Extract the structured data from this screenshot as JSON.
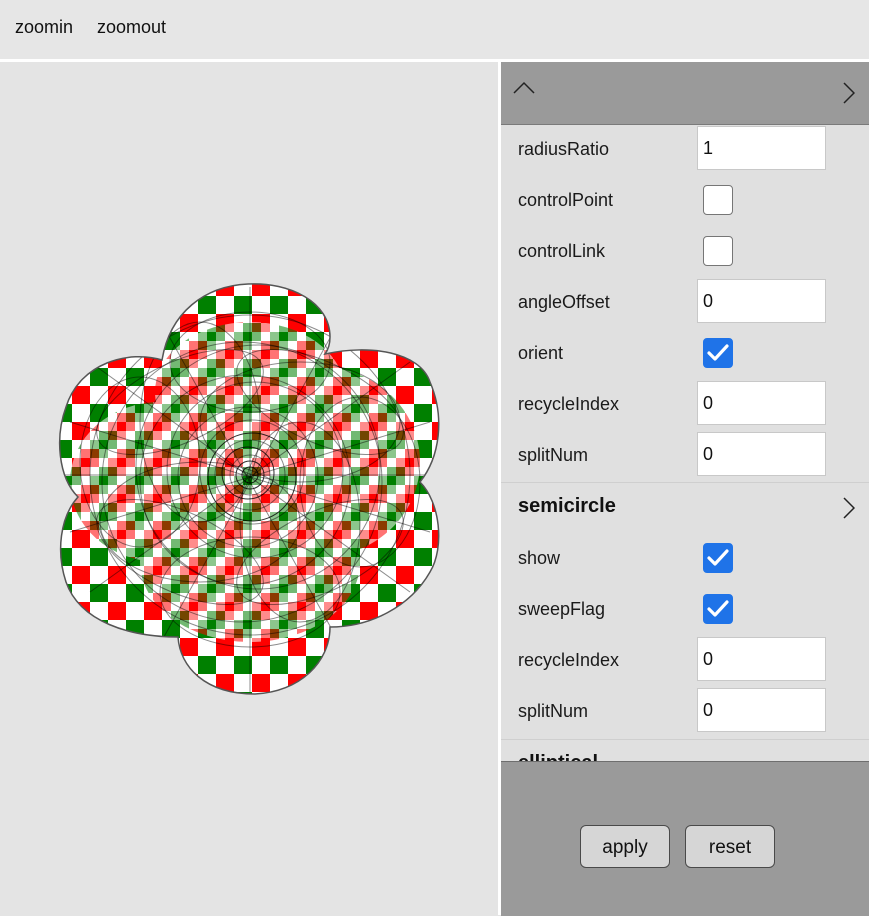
{
  "menu": {
    "zoomin": "zoomin",
    "zoomout": "zoomout"
  },
  "panel": {
    "fields": [
      {
        "key": "radiusRatio",
        "type": "number",
        "value": "1"
      },
      {
        "key": "controlPoint",
        "type": "checkbox",
        "checked": false
      },
      {
        "key": "controlLink",
        "type": "checkbox",
        "checked": false
      },
      {
        "key": "angleOffset",
        "type": "number",
        "value": "0"
      },
      {
        "key": "orient",
        "type": "checkbox",
        "checked": true
      },
      {
        "key": "recycleIndex",
        "type": "number",
        "value": "0"
      },
      {
        "key": "splitNum",
        "type": "number",
        "value": "0"
      }
    ],
    "sections": [
      {
        "title": "semicircle",
        "fields": [
          {
            "key": "show",
            "type": "checkbox",
            "checked": true
          },
          {
            "key": "sweepFlag",
            "type": "checkbox",
            "checked": true
          },
          {
            "key": "recycleIndex",
            "type": "number",
            "value": "0"
          },
          {
            "key": "splitNum",
            "type": "number",
            "value": "0"
          }
        ]
      },
      {
        "title": "elliptical"
      }
    ],
    "buttons": {
      "apply": "apply",
      "reset": "reset"
    }
  },
  "colors": {
    "checker_red": "#ff0000",
    "checker_green": "#008000",
    "checker_white": "#ffffff",
    "checkbox_checked": "#1f73e8",
    "panel_chrome": "#9a9a9a"
  },
  "icons": {
    "header_left": "chevron-up-icon",
    "header_right": "chevron-right-icon",
    "section_toggle": "chevron-right-icon",
    "checkbox_mark": "checkmark-icon"
  }
}
